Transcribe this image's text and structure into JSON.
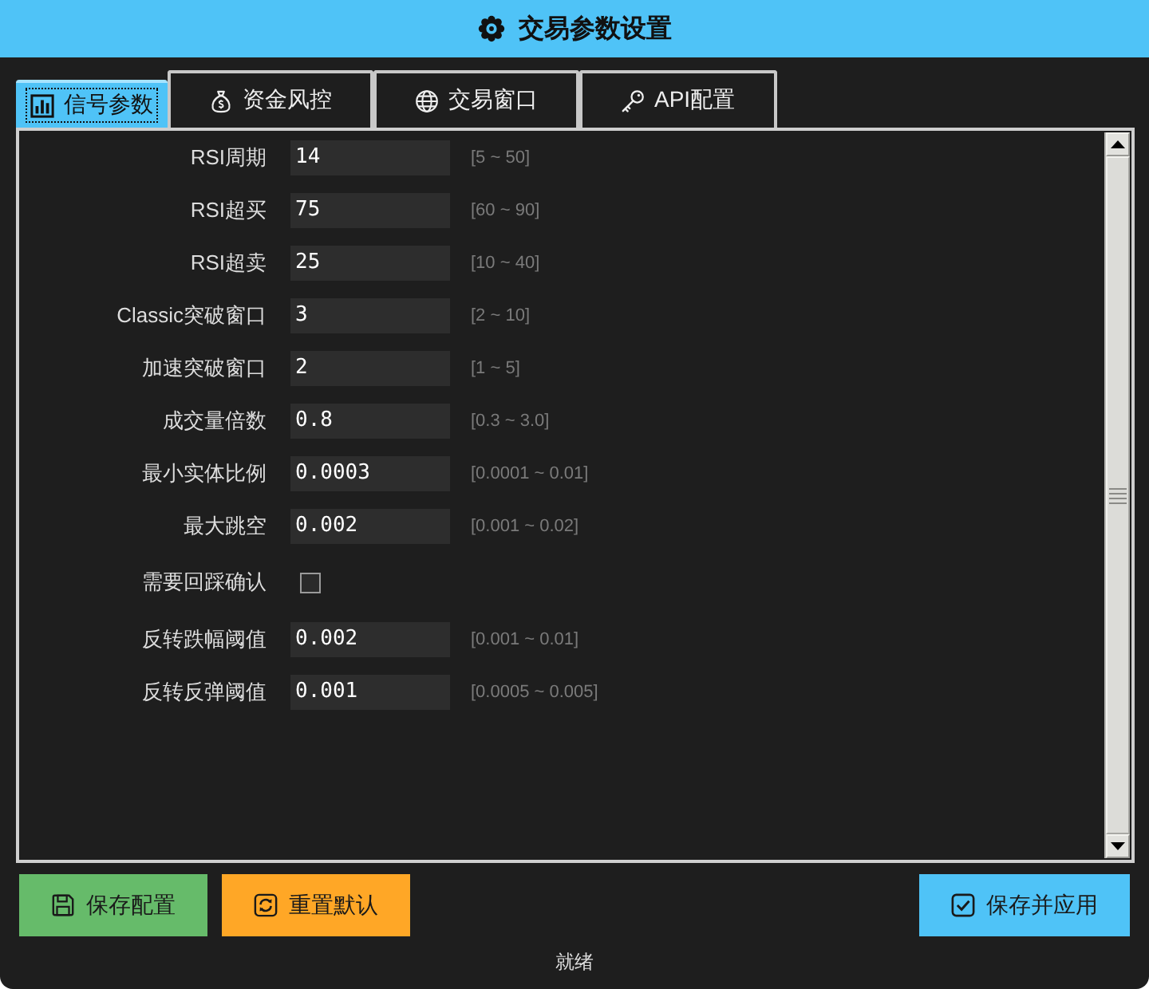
{
  "window": {
    "title": "交易参数设置"
  },
  "tabs": [
    {
      "label": "信号参数",
      "selected": true
    },
    {
      "label": "资金风控",
      "selected": false
    },
    {
      "label": "交易窗口",
      "selected": false
    },
    {
      "label": "API配置",
      "selected": false
    }
  ],
  "params": [
    {
      "kind": "input",
      "label": "RSI周期",
      "value": "14",
      "range": "[5 ~ 50]"
    },
    {
      "kind": "input",
      "label": "RSI超买",
      "value": "75",
      "range": "[60 ~ 90]"
    },
    {
      "kind": "input",
      "label": "RSI超卖",
      "value": "25",
      "range": "[10 ~ 40]"
    },
    {
      "kind": "input",
      "label": "Classic突破窗口",
      "value": "3",
      "range": "[2 ~ 10]"
    },
    {
      "kind": "input",
      "label": "加速突破窗口",
      "value": "2",
      "range": "[1 ~ 5]"
    },
    {
      "kind": "input",
      "label": "成交量倍数",
      "value": "0.8",
      "range": "[0.3 ~ 3.0]"
    },
    {
      "kind": "input",
      "label": "最小实体比例",
      "value": "0.0003",
      "range": "[0.0001 ~ 0.01]"
    },
    {
      "kind": "input",
      "label": "最大跳空",
      "value": "0.002",
      "range": "[0.001 ~ 0.02]"
    },
    {
      "kind": "checkbox",
      "label": "需要回踩确认",
      "checked": false
    },
    {
      "kind": "input",
      "label": "反转跌幅阈值",
      "value": "0.002",
      "range": "[0.001 ~ 0.01]"
    },
    {
      "kind": "input",
      "label": "反转反弹阈值",
      "value": "0.001",
      "range": "[0.0005 ~ 0.005]"
    }
  ],
  "buttons": [
    {
      "label": "保存配置",
      "color": "#66bb6a"
    },
    {
      "label": "重置默认",
      "color": "#ffa726"
    },
    {
      "label": "保存并应用",
      "color": "#4fc3f7"
    }
  ],
  "status_bar": {
    "text": "就绪"
  }
}
